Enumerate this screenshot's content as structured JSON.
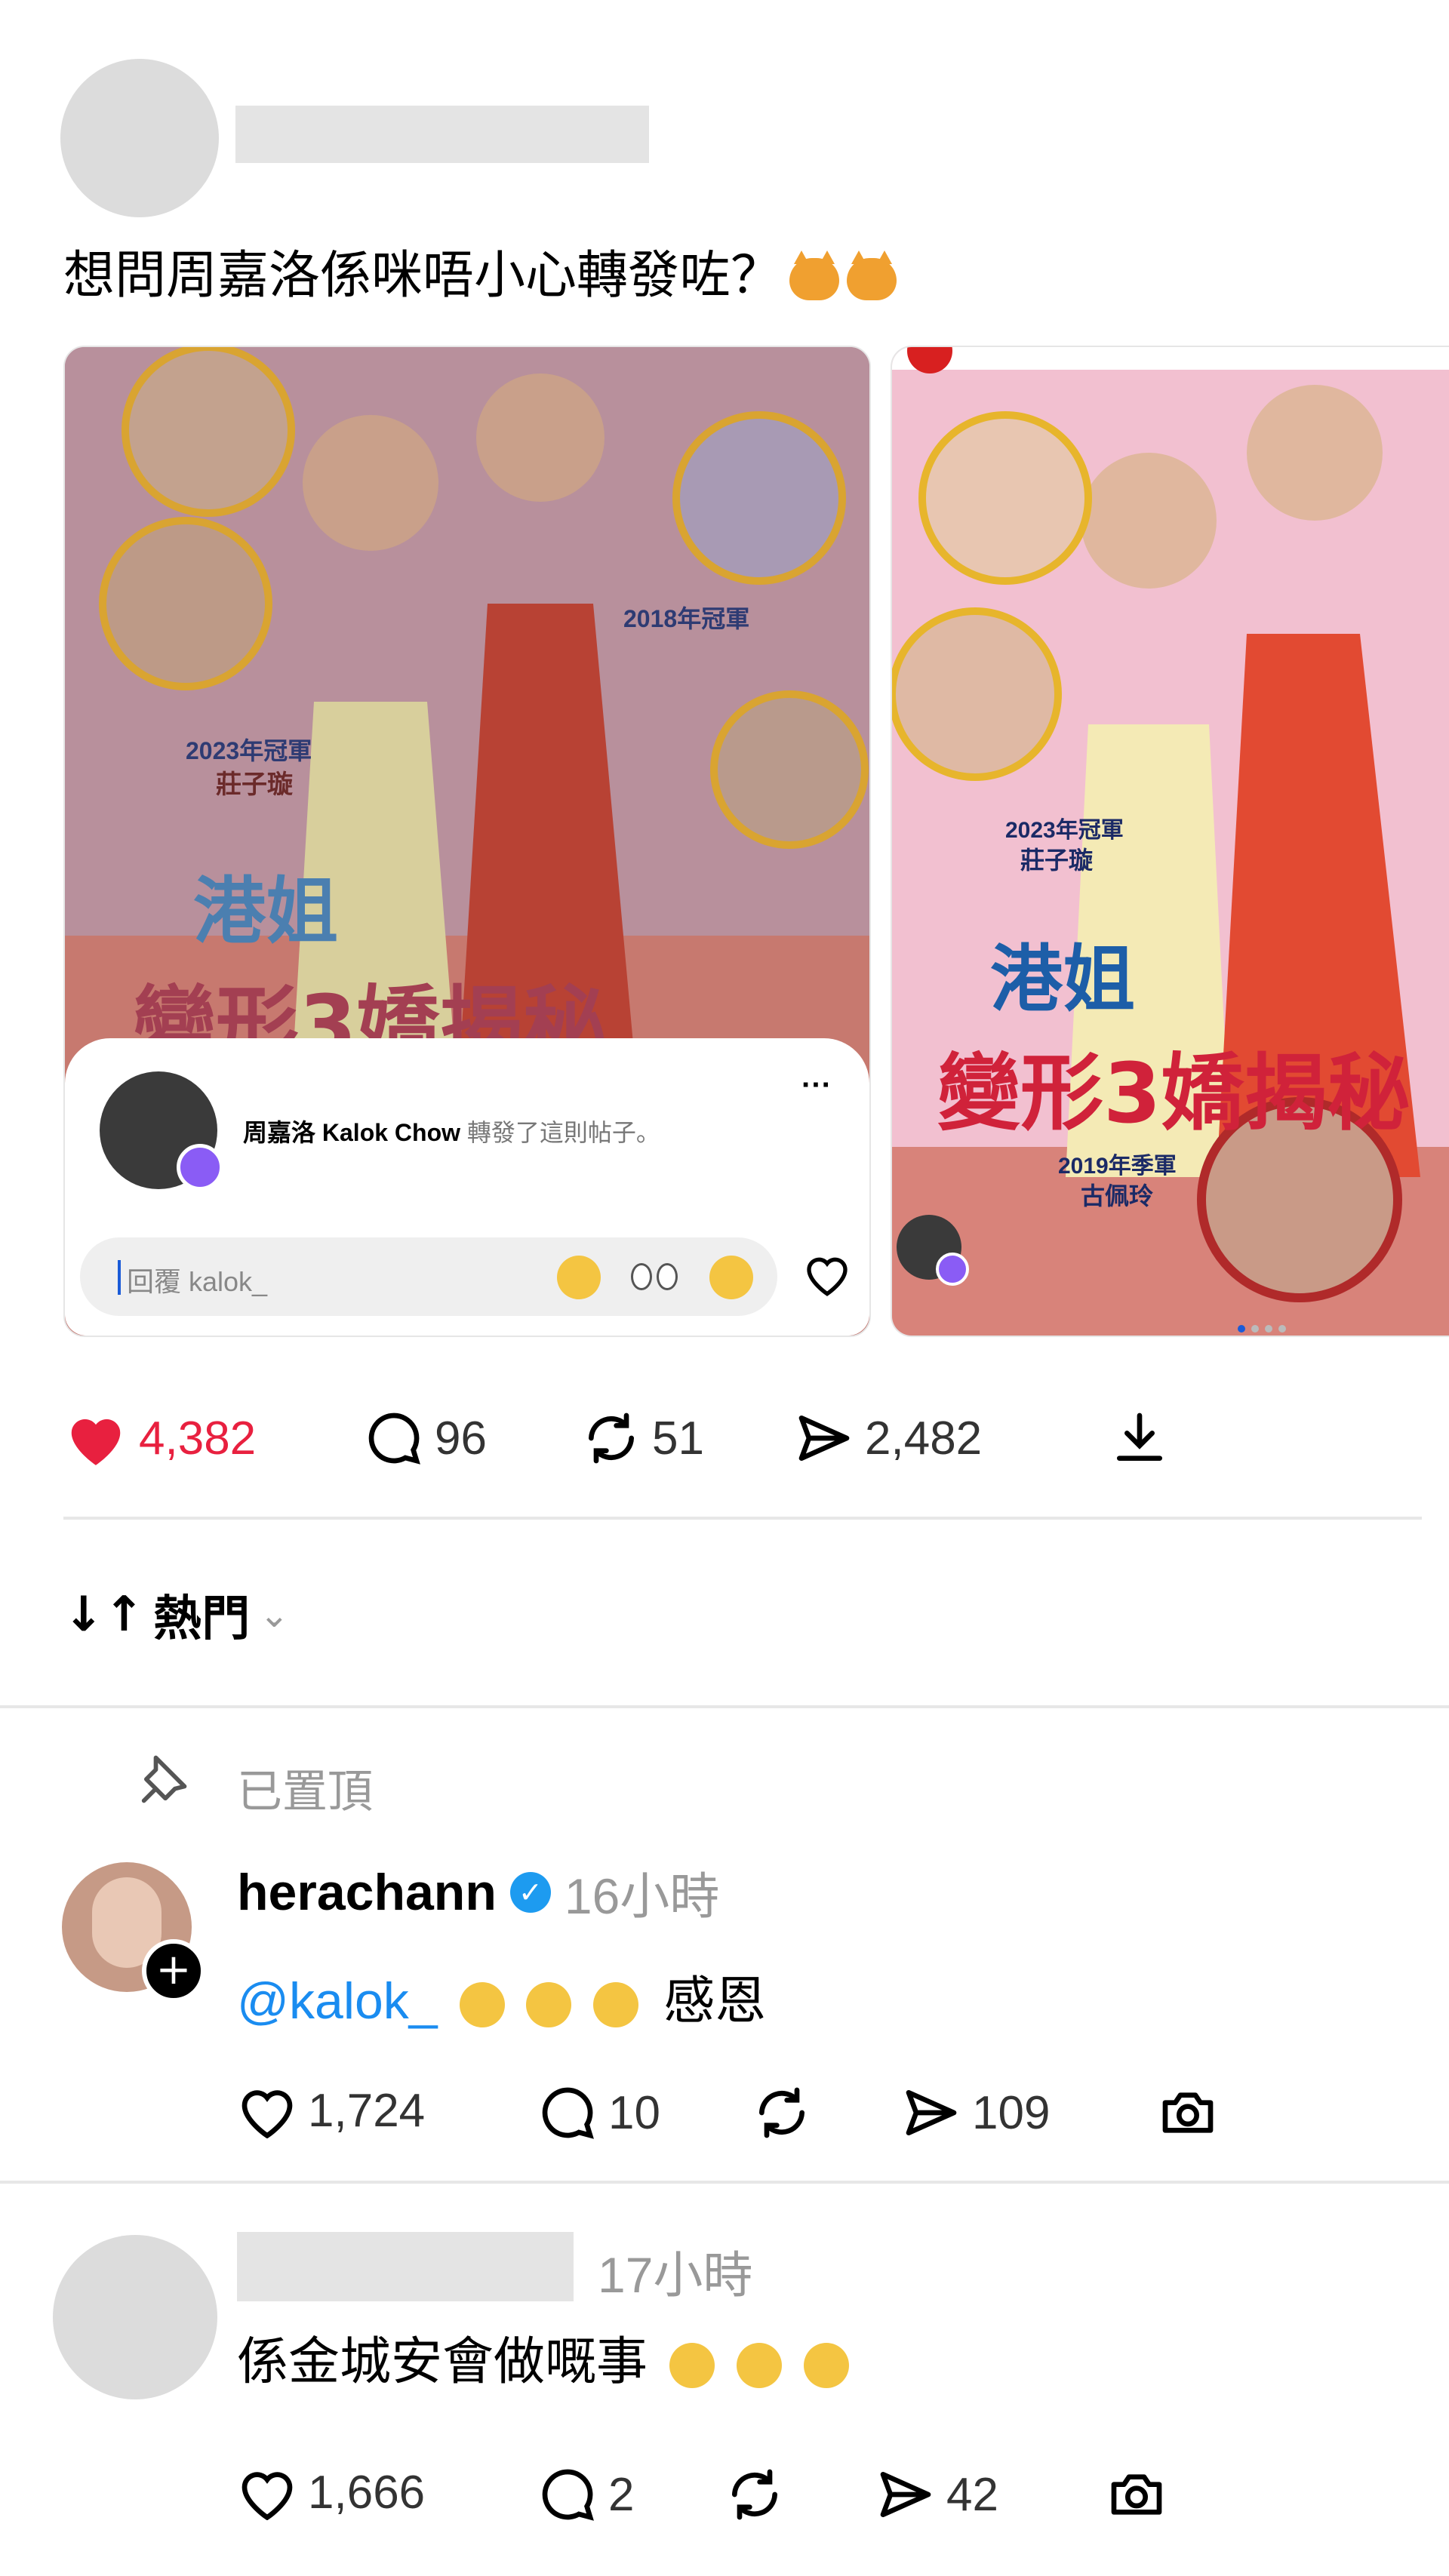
{
  "post": {
    "text": "想問周嘉洛係咪唔小心轉發咗？",
    "carousel": {
      "img1": {
        "title_lines": [
          "港姐",
          "變形3嬌揭秘"
        ],
        "labels": [
          "2018年冠軍",
          "2023年冠軍",
          "莊子璇"
        ]
      },
      "repost_overlay": {
        "reposter_name": "周嘉洛 Kalok Chow",
        "repost_text": "轉發了這則帖子。",
        "more_label": "···",
        "reply_placeholder": "回覆 kalok_"
      },
      "img2": {
        "title_lines": [
          "港姐",
          "變形3嬌揭秘"
        ],
        "labels": [
          "2023年冠軍",
          "莊子璇",
          "2019年季軍",
          "古佩玲"
        ]
      }
    },
    "actions": {
      "likes": "4,382",
      "comments": "96",
      "reposts": "51",
      "shares": "2,482"
    }
  },
  "sort": {
    "label": "熱門"
  },
  "comments": [
    {
      "pinned_label": "已置頂",
      "username": "herachann",
      "verified": true,
      "time": "16小時",
      "mention": "@kalok_",
      "text": "感恩",
      "likes": "1,724",
      "comments": "10",
      "shares": "109"
    },
    {
      "time": "17小時",
      "text": "係金城安會做嘅事",
      "likes": "1,666",
      "comments": "2",
      "shares": "42"
    }
  ],
  "colors": {
    "like_red": "#e8203f",
    "mention_blue": "#1a8cf0",
    "verified_blue": "#1d9bf0",
    "repost_purple": "#8a5cf5"
  }
}
